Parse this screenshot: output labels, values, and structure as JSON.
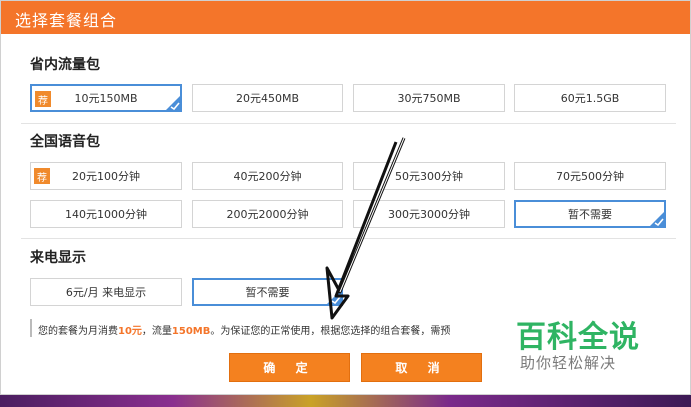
{
  "dialog": {
    "title": "选择套餐组合",
    "sections": [
      {
        "title": "省内流量包",
        "options": [
          {
            "label": "10元150MB",
            "recommended": true,
            "selected": true
          },
          {
            "label": "20元450MB",
            "recommended": false,
            "selected": false
          },
          {
            "label": "30元750MB",
            "recommended": false,
            "selected": false
          },
          {
            "label": "60元1.5GB",
            "recommended": false,
            "selected": false
          }
        ]
      },
      {
        "title": "全国语音包",
        "options": [
          {
            "label": "20元100分钟",
            "recommended": true,
            "selected": false
          },
          {
            "label": "40元200分钟",
            "recommended": false,
            "selected": false
          },
          {
            "label": "50元300分钟",
            "recommended": false,
            "selected": false
          },
          {
            "label": "70元500分钟",
            "recommended": false,
            "selected": false
          },
          {
            "label": "140元1000分钟",
            "recommended": false,
            "selected": false
          },
          {
            "label": "200元2000分钟",
            "recommended": false,
            "selected": false
          },
          {
            "label": "300元3000分钟",
            "recommended": false,
            "selected": false
          },
          {
            "label": "暂不需要",
            "recommended": false,
            "selected": true
          }
        ]
      },
      {
        "title": "来电显示",
        "options": [
          {
            "label": "6元/月 来电显示",
            "recommended": false,
            "selected": false
          },
          {
            "label": "暂不需要",
            "recommended": false,
            "selected": true
          }
        ]
      }
    ],
    "recommend_badge": "荐",
    "note": {
      "prefix": "您的套餐为月消费",
      "price": "10元",
      "mid": "，流量",
      "data": "150MB",
      "suffix": "。为保证您的正常使用，根据您选择的组合套餐，需预"
    },
    "confirm_label": "确 定",
    "cancel_label": "取 消"
  },
  "watermark": {
    "title": "百科全说",
    "subtitle": "助你轻松解决"
  },
  "colors": {
    "accent": "#f4752a",
    "button": "#f4811f",
    "selected_border": "#4a8ed8",
    "watermark_green": "#2fb463"
  }
}
